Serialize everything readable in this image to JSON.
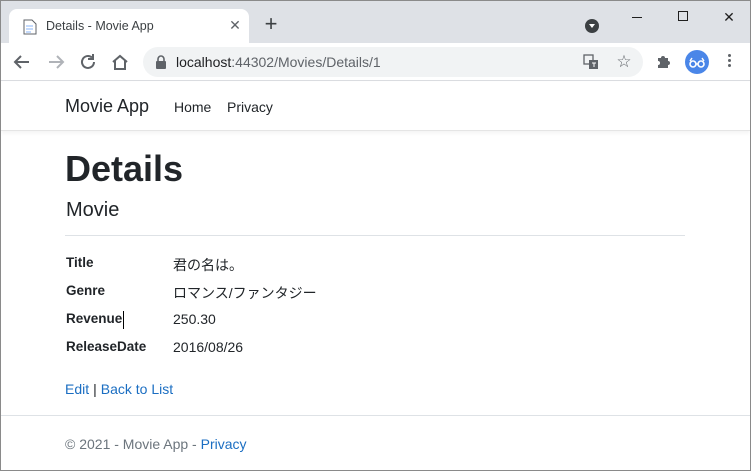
{
  "browser": {
    "tab_title": "Details - Movie App",
    "url_host": "localhost",
    "url_path": ":44302/Movies/Details/1"
  },
  "navbar": {
    "brand": "Movie App",
    "links": [
      "Home",
      "Privacy"
    ]
  },
  "details": {
    "heading": "Details",
    "subheading": "Movie",
    "fields": [
      {
        "label": "Title",
        "value": "君の名は。"
      },
      {
        "label": "Genre",
        "value": "ロマンス/ファンタジー"
      },
      {
        "label": "Revenue",
        "value": "250.30"
      },
      {
        "label": "ReleaseDate",
        "value": "2016/08/26"
      }
    ]
  },
  "actions": {
    "edit": "Edit",
    "separator": "|",
    "back": "Back to List"
  },
  "footer": {
    "text": "© 2021 - Movie App - ",
    "link": "Privacy"
  },
  "colors": {
    "link": "#1b6ec2",
    "tabstrip": "#dee1e6",
    "avatar": "#4a86e8"
  }
}
